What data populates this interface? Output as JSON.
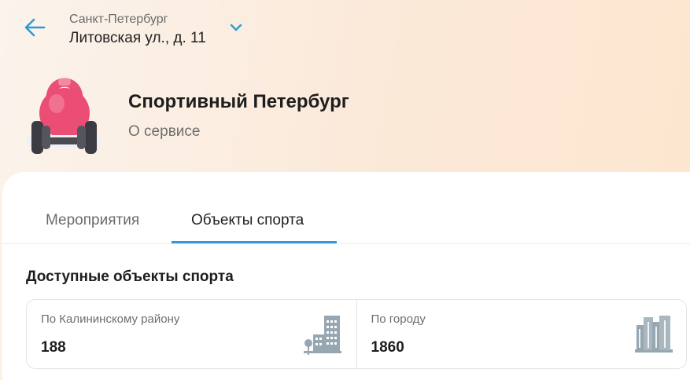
{
  "header": {
    "city": "Санкт-Петербург",
    "street": "Литовская ул., д. 11",
    "back_icon": "arrow-left-icon",
    "chevron_icon": "chevron-down-icon",
    "accent_color": "#2f9bd6"
  },
  "service": {
    "title": "Спортивный Петербург",
    "about_link": "О сервисе",
    "logo_icon": "kettlebell-dumbbell-icon"
  },
  "tabs": [
    {
      "label": "Мероприятия",
      "active": false
    },
    {
      "label": "Объекты спорта",
      "active": true
    }
  ],
  "section": {
    "title": "Доступные объекты спорта"
  },
  "stats": [
    {
      "label": "По Калининскому району",
      "value": "188",
      "icon": "district-buildings-icon"
    },
    {
      "label": "По городу",
      "value": "1860",
      "icon": "city-buildings-icon"
    }
  ]
}
